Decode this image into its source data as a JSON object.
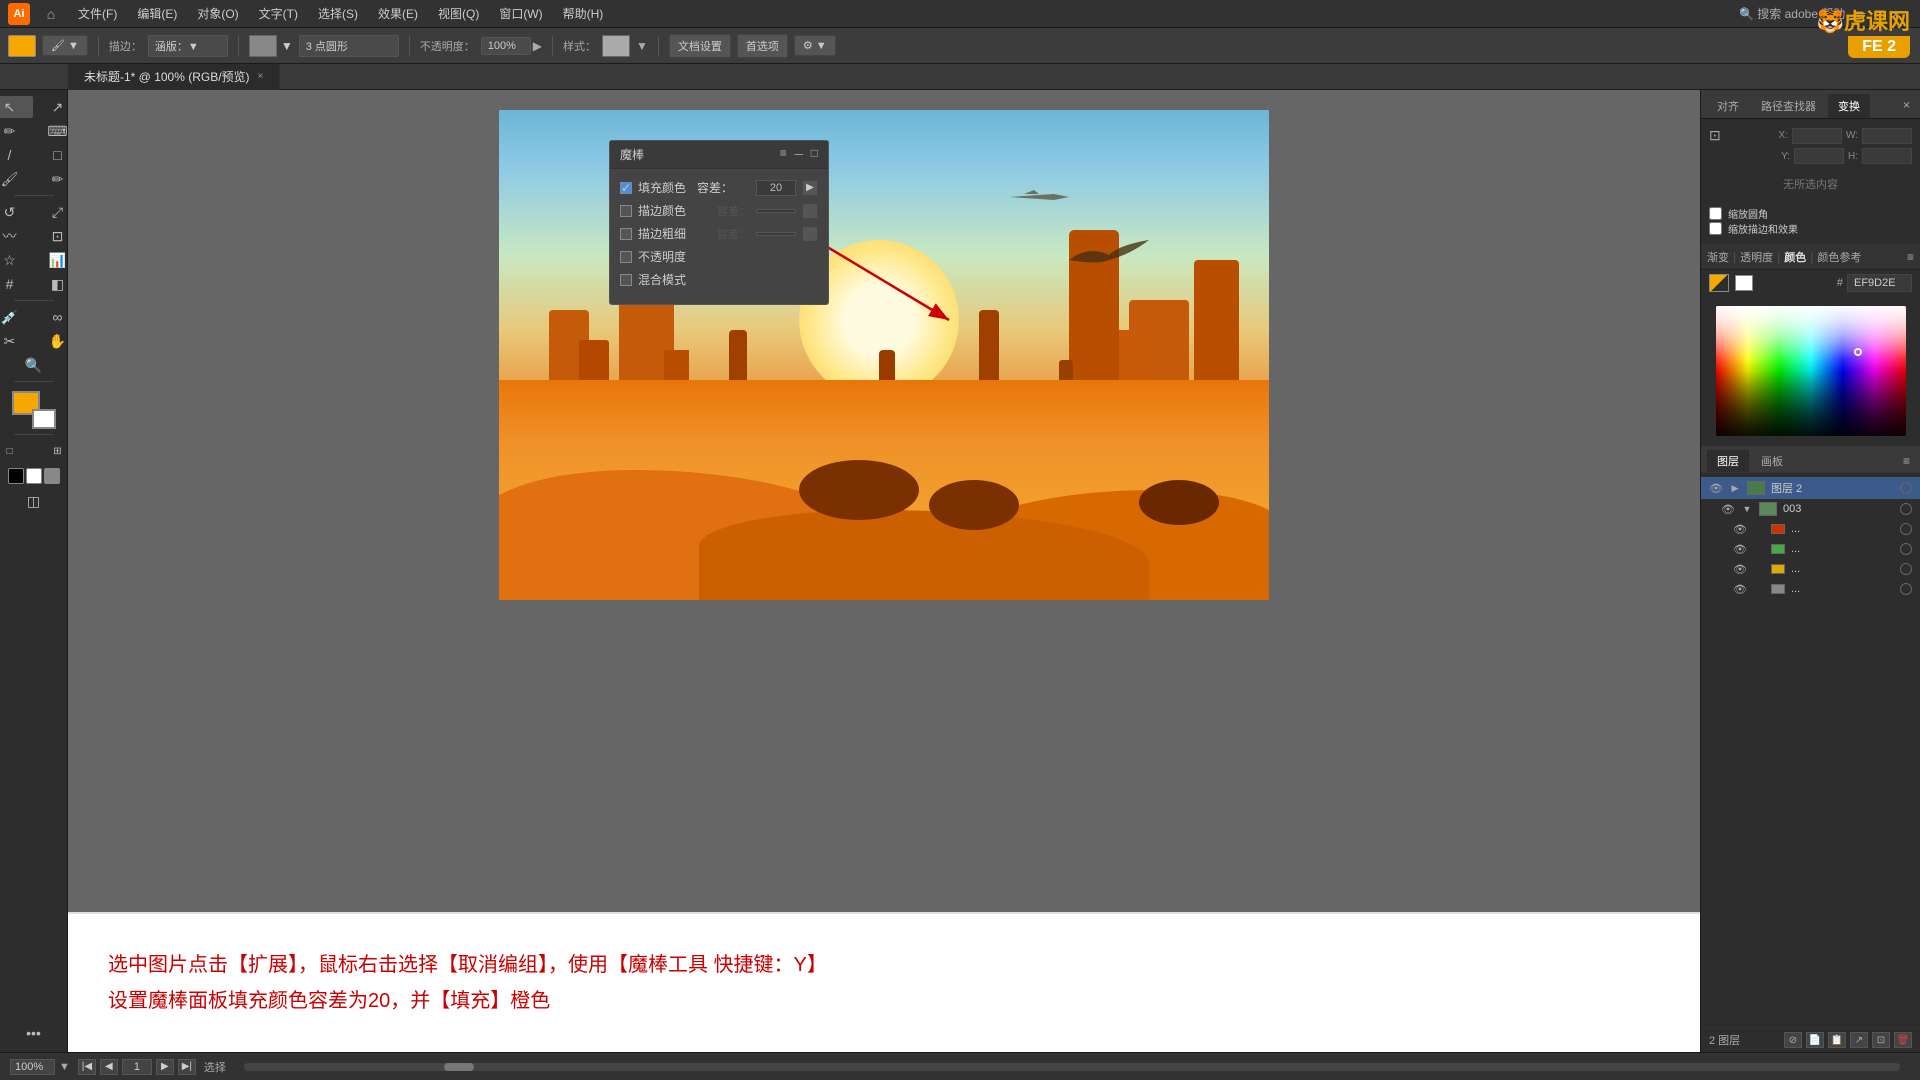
{
  "app": {
    "title": "Adobe Illustrator",
    "version": "AI"
  },
  "menubar": {
    "items": [
      "文件(F)",
      "编辑(E)",
      "对象(O)",
      "文字(T)",
      "选择(S)",
      "效果(E)",
      "视图(Q)",
      "窗口(W)",
      "帮助(H)"
    ]
  },
  "toolbar": {
    "color_swatch": "#f7a800",
    "mode_label": "描边：",
    "brush_label": "涵版：",
    "point_label": "3 点圆形",
    "opacity_label": "不透明度：",
    "opacity_value": "100%",
    "style_label": "样式：",
    "doc_settings": "文档设置",
    "preferences": "首选项"
  },
  "tab": {
    "label": "未标题-1* @ 100% (RGB/预览)",
    "close": "×"
  },
  "magic_panel": {
    "title": "魔棒",
    "fill_color_label": "填充颜色",
    "fill_color_checked": true,
    "fill_tolerance_label": "容差：",
    "fill_tolerance_value": "20",
    "stroke_color_label": "描边颜色",
    "stroke_width_label": "描边粗细",
    "opacity_label": "不透明度",
    "blend_label": "混合模式"
  },
  "instruction": {
    "line1": "选中图片点击【扩展】，鼠标右击选择【取消编组】，使用【魔棒工具 快捷键：Y】",
    "line2": "设置魔棒面板填充颜色容差为20，并【填充】橙色"
  },
  "right_panel": {
    "tabs": [
      "对齐",
      "路径查找器",
      "变换"
    ],
    "active_tab": "变换",
    "color_hex": "EF9D2E",
    "color_tabs": [
      "渐变",
      "透明度",
      "颜色",
      "颜色参考"
    ],
    "swatches": [
      {
        "color": "#ffffff",
        "name": "white"
      },
      {
        "color": "#000000",
        "name": "black"
      }
    ]
  },
  "layers_panel": {
    "tabs": [
      "图层",
      "画板"
    ],
    "active_tab": "图层",
    "items": [
      {
        "name": "图层 2",
        "indent": 0,
        "expanded": true,
        "selected": true,
        "thumb_color": "#4a7a4a"
      },
      {
        "name": "003",
        "indent": 1,
        "expanded": false,
        "thumb_color": "#5a8a5a"
      },
      {
        "name": "...",
        "indent": 2,
        "color": "#cc3300"
      },
      {
        "name": "...",
        "indent": 2,
        "color": "#44aa44"
      },
      {
        "name": "...",
        "indent": 2,
        "color": "#ddaa00"
      },
      {
        "name": "...",
        "indent": 2,
        "color": "#888888"
      }
    ],
    "bottom_label": "2 图层"
  },
  "status_bar": {
    "zoom": "100%",
    "page": "1",
    "mode": "选择"
  },
  "watermark": {
    "site": "虎课网",
    "label": "FE 2"
  }
}
